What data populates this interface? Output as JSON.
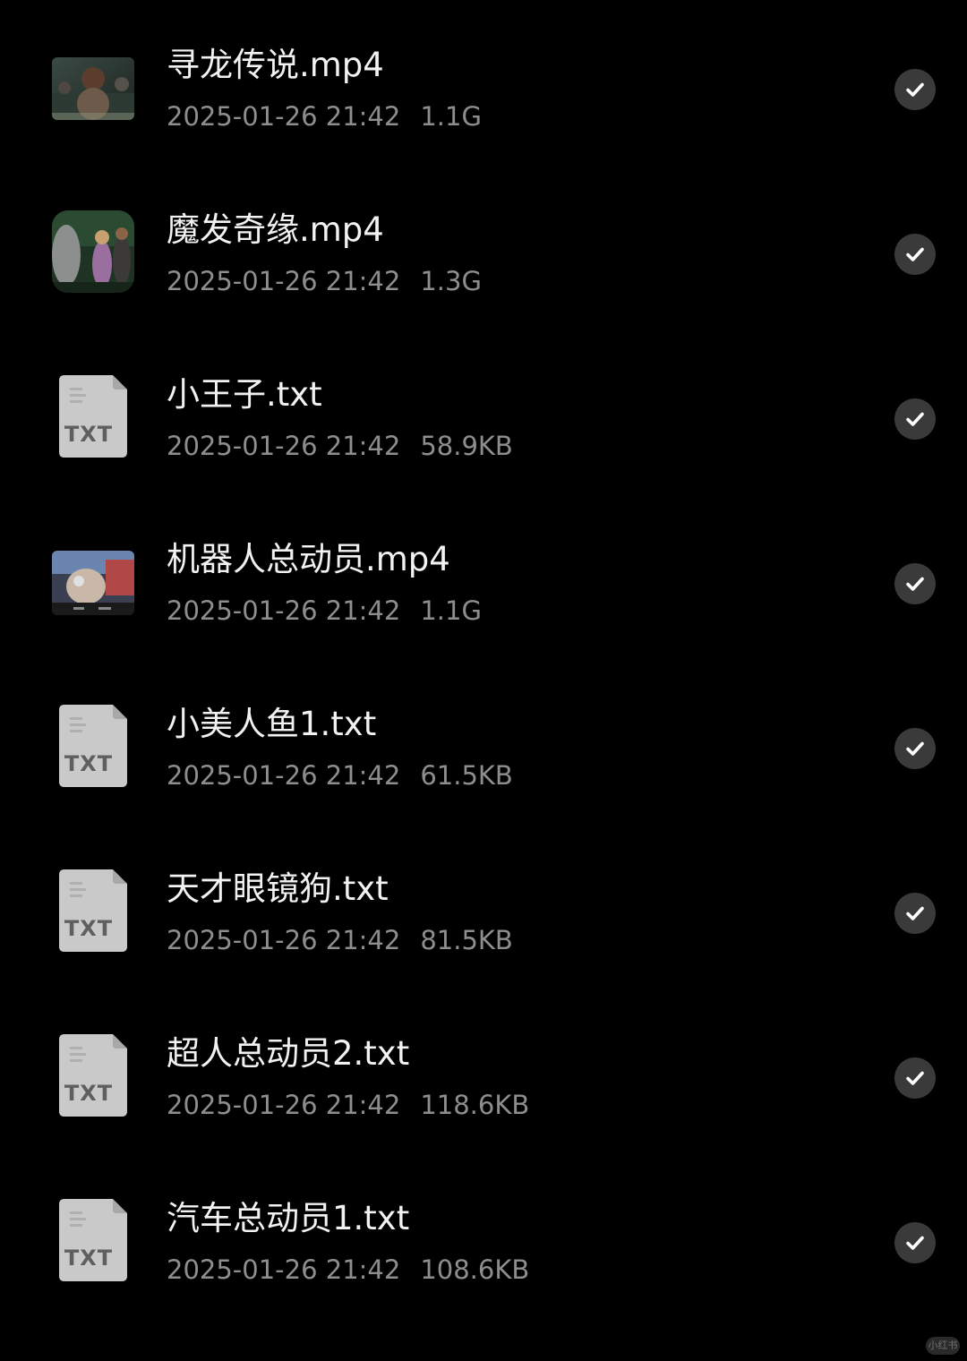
{
  "files": [
    {
      "name": "寻龙传说.mp4",
      "date": "2025-01-26 21:42",
      "size": "1.1G",
      "type": "video",
      "icon": "video-thumbnail-icon",
      "selected": true
    },
    {
      "name": "魔发奇缘.mp4",
      "date": "2025-01-26 21:42",
      "size": "1.3G",
      "type": "video",
      "icon": "video-thumbnail-icon",
      "selected": true
    },
    {
      "name": "小王子.txt",
      "date": "2025-01-26 21:42",
      "size": "58.9KB",
      "type": "txt",
      "icon": "txt-file-icon",
      "icon_label": "TXT",
      "selected": true
    },
    {
      "name": "机器人总动员.mp4",
      "date": "2025-01-26 21:42",
      "size": "1.1G",
      "type": "video",
      "icon": "video-thumbnail-icon",
      "selected": true
    },
    {
      "name": "小美人鱼1.txt",
      "date": "2025-01-26 21:42",
      "size": "61.5KB",
      "type": "txt",
      "icon": "txt-file-icon",
      "icon_label": "TXT",
      "selected": true
    },
    {
      "name": "天才眼镜狗.txt",
      "date": "2025-01-26 21:42",
      "size": "81.5KB",
      "type": "txt",
      "icon": "txt-file-icon",
      "icon_label": "TXT",
      "selected": true
    },
    {
      "name": "超人总动员2.txt",
      "date": "2025-01-26 21:42",
      "size": "118.6KB",
      "type": "txt",
      "icon": "txt-file-icon",
      "icon_label": "TXT",
      "selected": true
    },
    {
      "name": "汽车总动员1.txt",
      "date": "2025-01-26 21:42",
      "size": "108.6KB",
      "type": "txt",
      "icon": "txt-file-icon",
      "icon_label": "TXT",
      "selected": true
    }
  ],
  "colors": {
    "background": "#000000",
    "name_text": "#f2f2f2",
    "meta_text": "#8e8e8e",
    "check_bg": "#3a3a3a",
    "txt_icon": "#c9c9c9"
  },
  "watermark": "小红书"
}
